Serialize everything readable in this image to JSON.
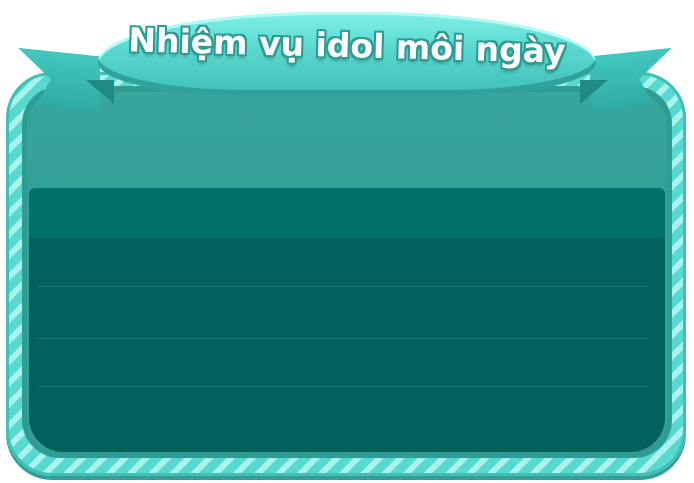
{
  "dialog": {
    "title": "Nhiệm vụ idol môi ngày"
  },
  "colors": {
    "frame_stripe_light": "#a8f3ec",
    "frame_stripe_dark": "#58d9cf",
    "panel": "#37a29a",
    "list_background": "#01625c",
    "list_header": "#02706a",
    "ribbon": "#5ad8cf"
  },
  "task_list": {
    "rows": 4
  }
}
